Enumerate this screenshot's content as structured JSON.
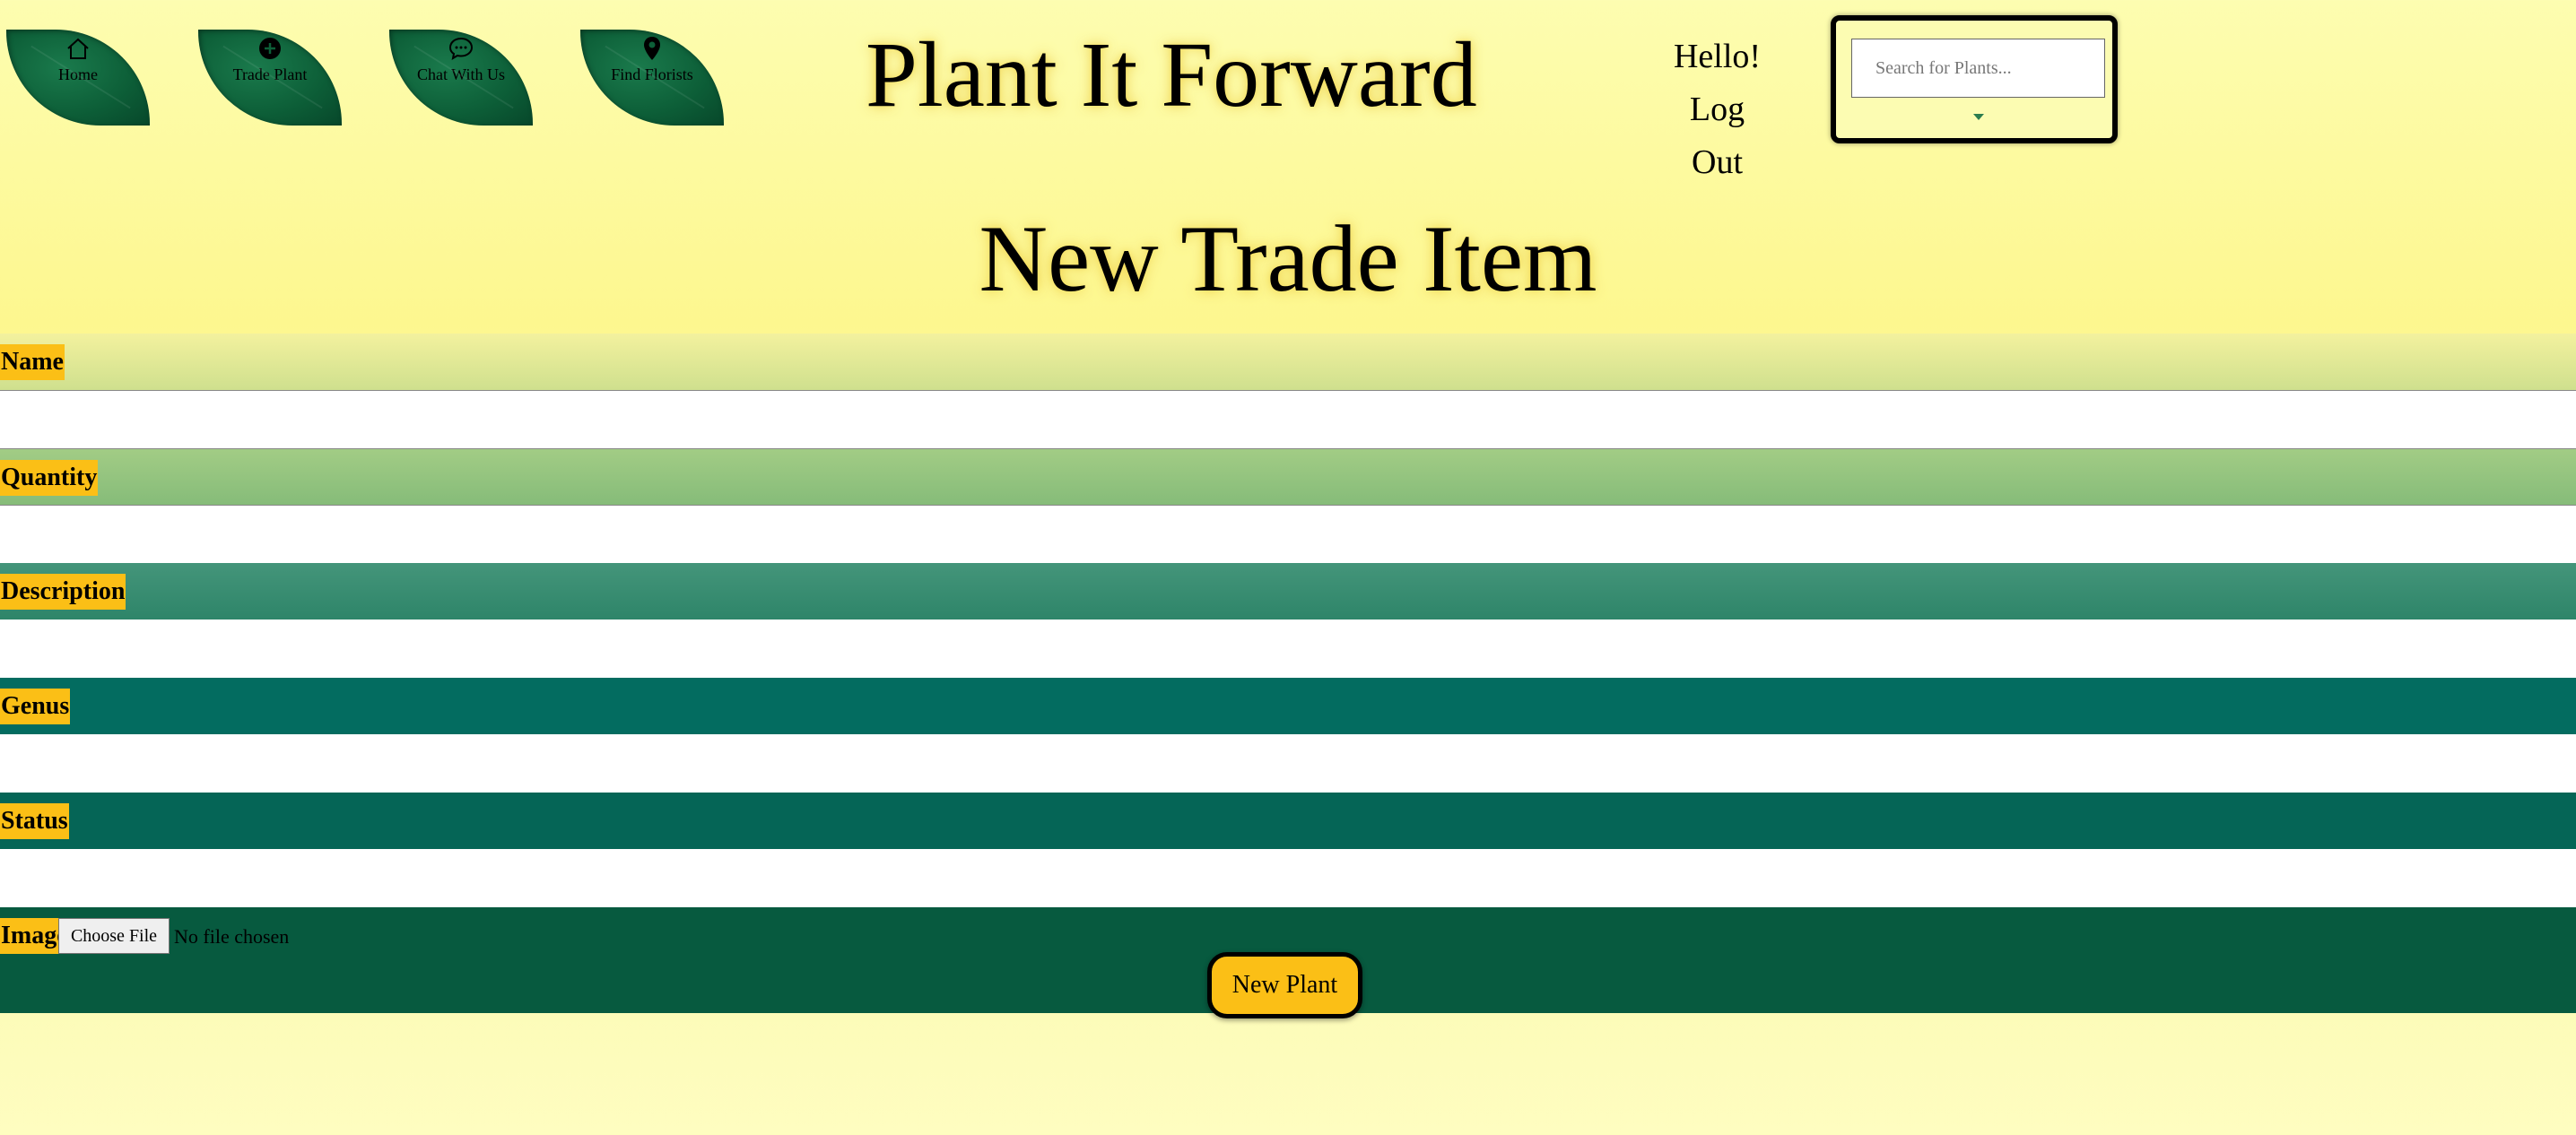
{
  "nav": {
    "items": [
      {
        "label": "Home",
        "icon": "home-icon"
      },
      {
        "label": "Trade Plant",
        "icon": "plus-circle-icon"
      },
      {
        "label": "Chat With Us",
        "icon": "chat-bubble-icon"
      },
      {
        "label": "Find Florists",
        "icon": "map-pin-icon"
      }
    ]
  },
  "header": {
    "site_title": "Plant It Forward",
    "greeting": "Hello!",
    "logout_label": "Log Out"
  },
  "search": {
    "placeholder": "Search for Plants..."
  },
  "page": {
    "title": "New Trade Item"
  },
  "form": {
    "fields": [
      {
        "label": "Name",
        "value": ""
      },
      {
        "label": "Quantity",
        "value": ""
      },
      {
        "label": "Description",
        "value": ""
      },
      {
        "label": "Genus",
        "value": ""
      },
      {
        "label": "Status",
        "value": ""
      }
    ],
    "image_label": "Image",
    "file_button_label": "Choose File",
    "file_status": "No file chosen",
    "submit_label": "New Plant"
  },
  "colors": {
    "label_bg": "#fbbf16",
    "band_colors": [
      "#d4e38f",
      "#8cc07a",
      "#3a8d6f",
      "#046b5e",
      "#056656",
      "#075a3f"
    ]
  }
}
